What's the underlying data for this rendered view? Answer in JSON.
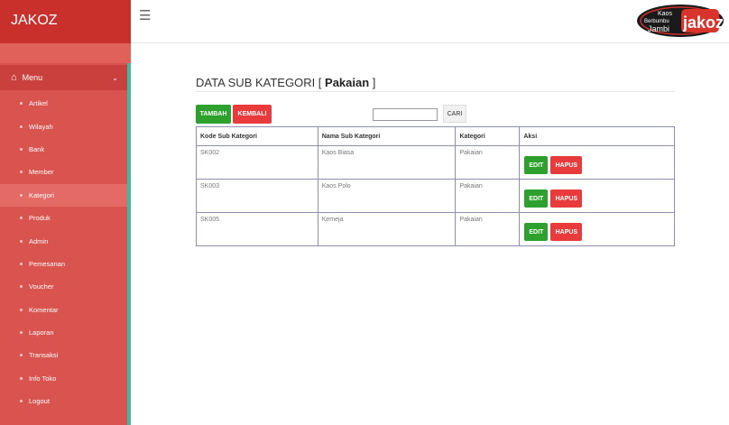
{
  "brand": {
    "name": "JAKOZ"
  },
  "logo": {
    "line1": "Kaos",
    "line2": "Berbumbu",
    "line3": "Jambi",
    "mark": "jakoz"
  },
  "sidebar": {
    "menu_label": "Menu",
    "items": [
      {
        "label": "Artikel"
      },
      {
        "label": "Wilayah"
      },
      {
        "label": "Bank"
      },
      {
        "label": "Member"
      },
      {
        "label": "Kategori"
      },
      {
        "label": "Produk"
      },
      {
        "label": "Admin"
      },
      {
        "label": "Pemesanan"
      },
      {
        "label": "Voucher"
      },
      {
        "label": "Komentar"
      },
      {
        "label": "Laporan"
      },
      {
        "label": "Transaksi"
      },
      {
        "label": "Info Toko"
      },
      {
        "label": "Logout"
      }
    ],
    "active_item": "Kategori"
  },
  "page": {
    "title_prefix": "DATA SUB KATEGORI [ ",
    "title_bold": "Pakaian",
    "title_suffix": " ]"
  },
  "toolbar": {
    "tambah_label": "TAMBAH",
    "kembali_label": "KEMBALI",
    "search_value": "",
    "cari_label": "CARI"
  },
  "table": {
    "headers": [
      "Kode Sub Kategori",
      "Nama Sub Kategori",
      "Kategori",
      "Aksi"
    ],
    "rows": [
      {
        "kode": "SK002",
        "nama": "Kaos Biasa",
        "kategori": "Pakaian"
      },
      {
        "kode": "SK003",
        "nama": "Kaos Polo",
        "kategori": "Pakaian"
      },
      {
        "kode": "SK005",
        "nama": "Kemeja",
        "kategori": "Pakaian"
      }
    ],
    "edit_label": "EDIT",
    "hapus_label": "HAPUS"
  },
  "colors": {
    "sidebar": "#d9534f",
    "brand_bar": "#c9302c",
    "accent_border": "#3fb9a3",
    "button_green": "#2da02d",
    "button_red": "#e93b3b"
  }
}
